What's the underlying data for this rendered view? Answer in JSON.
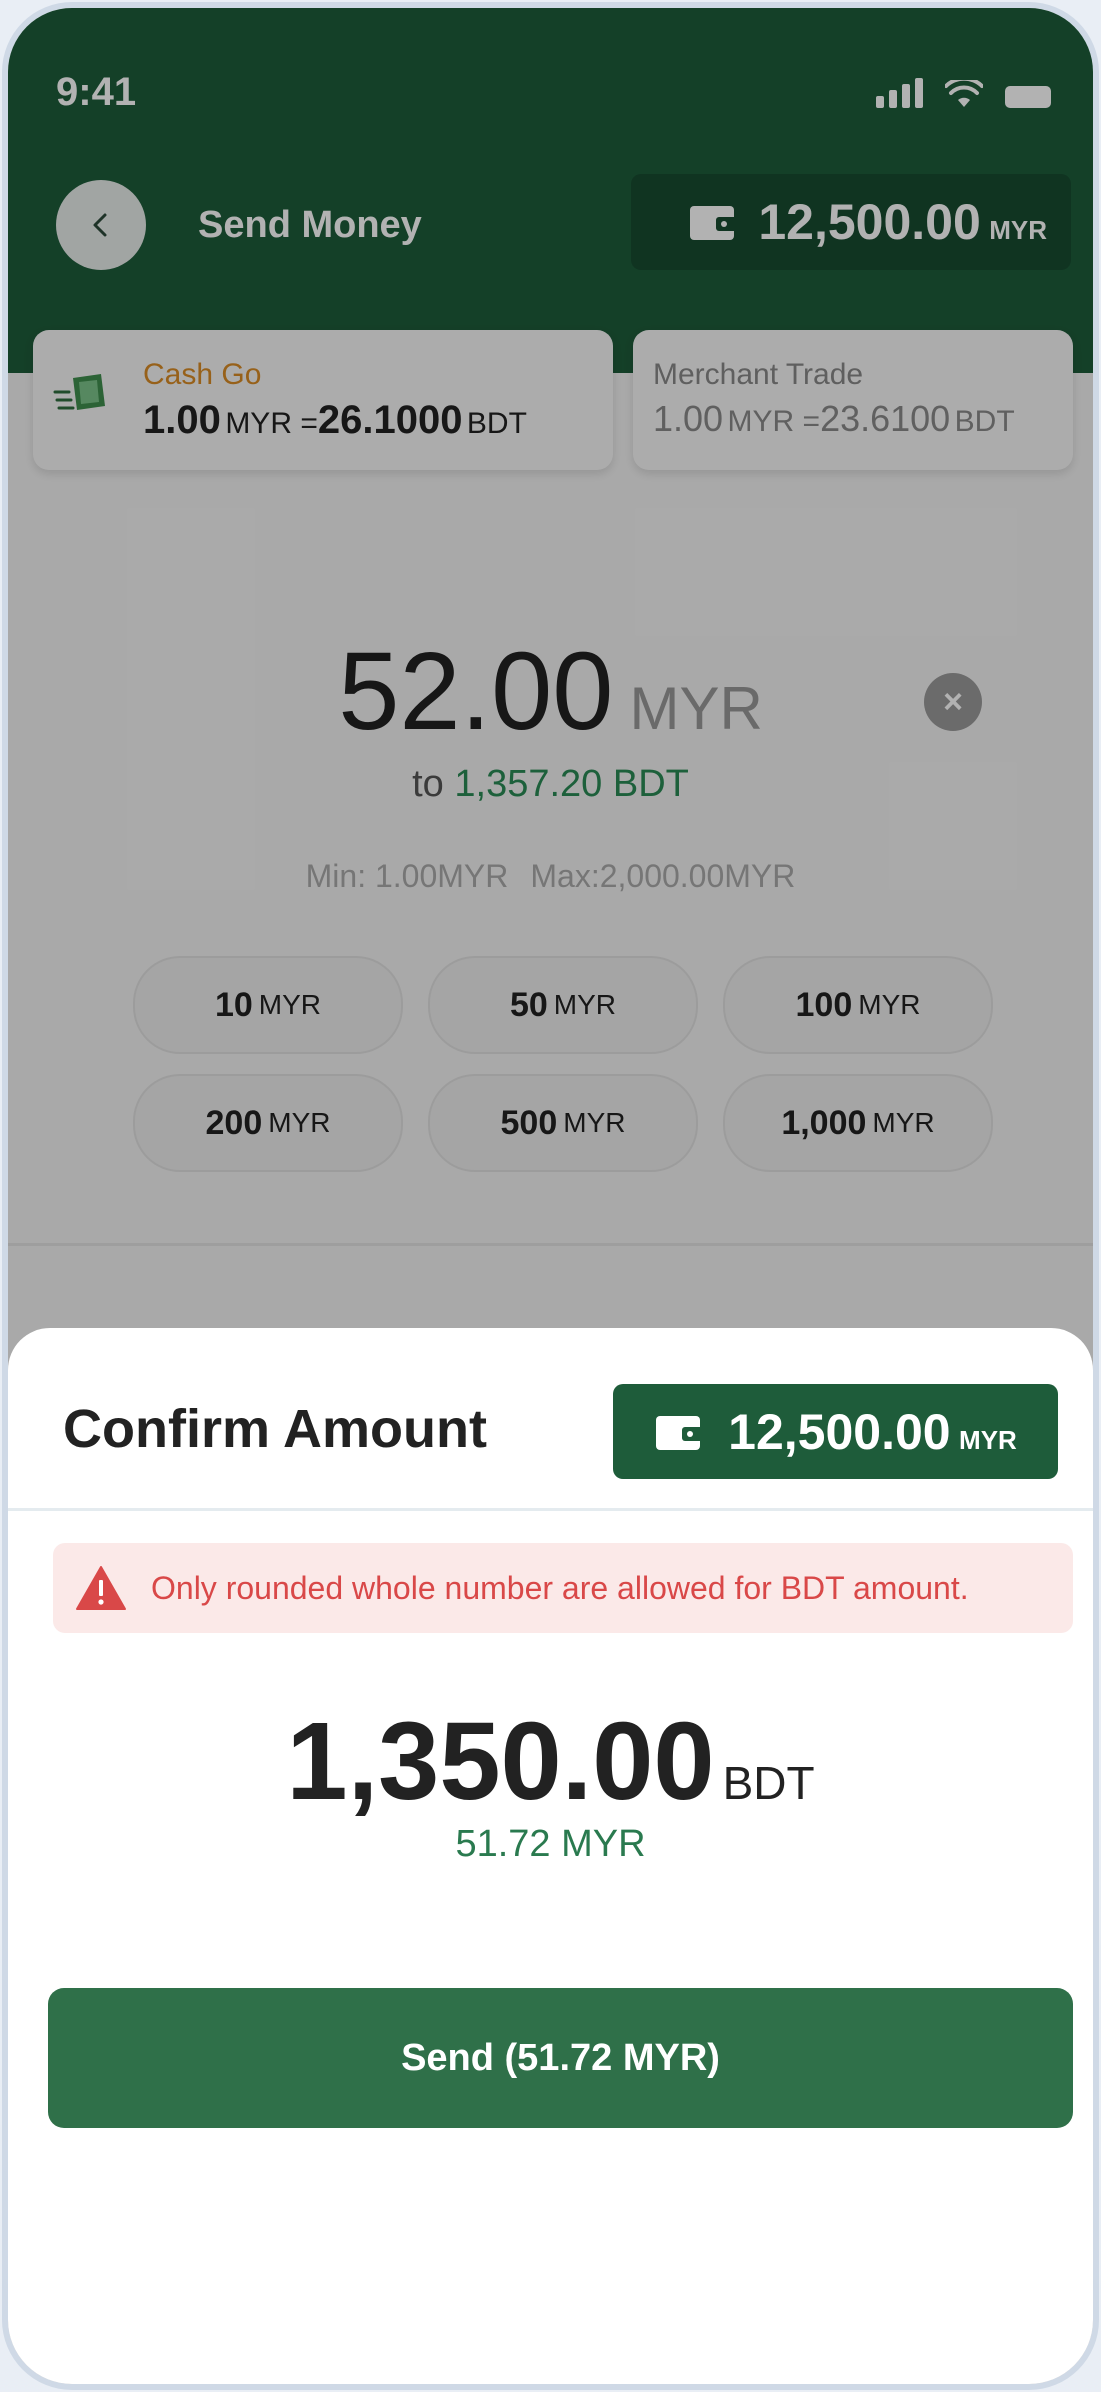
{
  "status_bar": {
    "time": "9:41"
  },
  "header": {
    "title": "Send Money",
    "balance": {
      "amount": "12,500.00",
      "currency": "MYR"
    }
  },
  "rate_cards": [
    {
      "name": "Cash Go",
      "base": "1.00",
      "base_cur": "MYR =",
      "rate": "26.1000",
      "rate_cur": "BDT",
      "selected": true
    },
    {
      "name": "Merchant Trade",
      "base": "1.00",
      "base_cur": "MYR =",
      "rate": "23.6100",
      "rate_cur": "BDT",
      "selected": false
    }
  ],
  "amount": {
    "value": "52.00",
    "currency": "MYR",
    "to_prefix": "to",
    "to_value": "1,357.20 BDT",
    "min": "Min: 1.00MYR",
    "max": "Max:2,000.00MYR"
  },
  "quick_amounts": [
    {
      "value": "10",
      "currency": "MYR"
    },
    {
      "value": "50",
      "currency": "MYR"
    },
    {
      "value": "100",
      "currency": "MYR"
    },
    {
      "value": "200",
      "currency": "MYR"
    },
    {
      "value": "500",
      "currency": "MYR"
    },
    {
      "value": "1,000",
      "currency": "MYR"
    }
  ],
  "sheet": {
    "title": "Confirm Amount",
    "balance": {
      "amount": "12,500.00",
      "currency": "MYR"
    },
    "warning": "Only rounded whole number are allowed for BDT amount.",
    "confirm_value": "1,350.00",
    "confirm_currency": "BDT",
    "confirm_sub": "51.72 MYR",
    "send_label": "Send (51.72 MYR)"
  },
  "colors": {
    "brand_green": "#1e5c3a",
    "button_green": "#2f7049",
    "warning_red": "#d94848",
    "accent_orange": "#d98b26"
  },
  "icons": [
    "chevron-left-icon",
    "wallet-icon",
    "signal-icon",
    "wifi-icon",
    "battery-icon",
    "close-icon",
    "warning-icon",
    "cash-go-logo-icon"
  ]
}
